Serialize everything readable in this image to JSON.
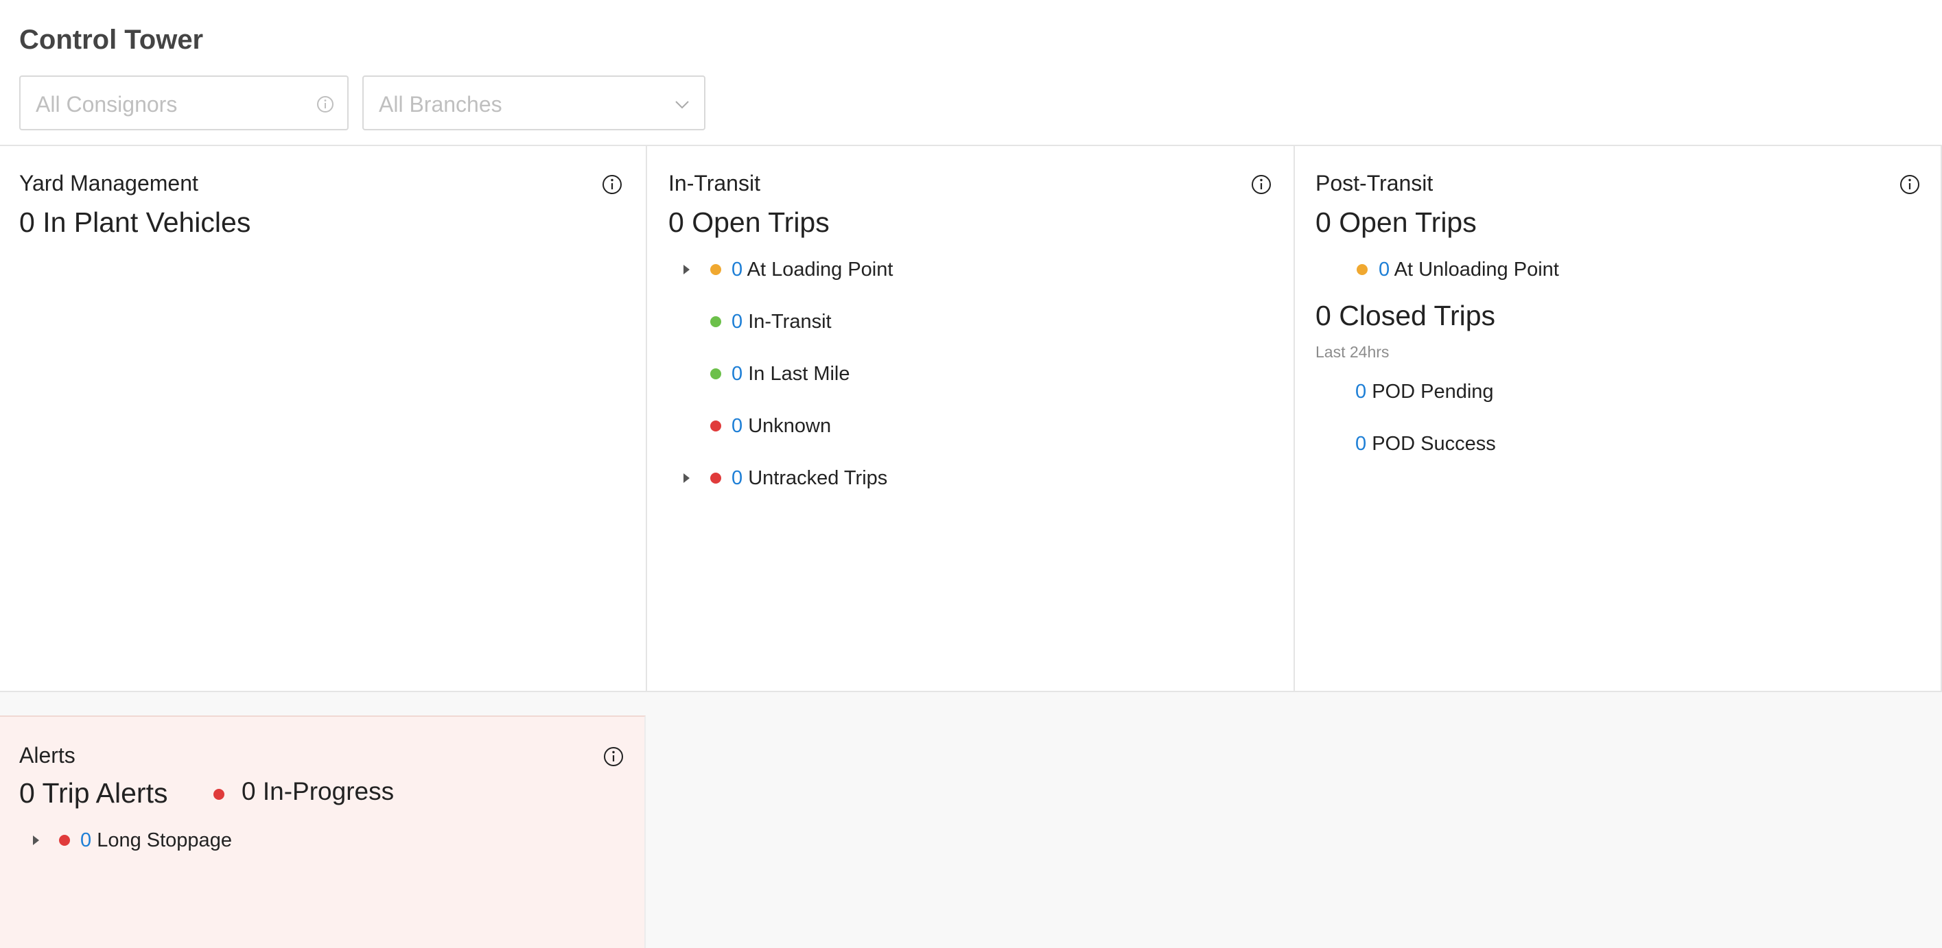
{
  "header": {
    "title": "Control Tower",
    "consignor_filter": {
      "placeholder": "All Consignors"
    },
    "branch_filter": {
      "placeholder": "All Branches"
    }
  },
  "colors": {
    "amber": "#f0a830",
    "green": "#6cc04a",
    "red": "#e03b3b",
    "link_blue": "#1e7fd6"
  },
  "yard": {
    "title": "Yard Management",
    "summary": "0 In Plant Vehicles"
  },
  "in_transit": {
    "title": "In-Transit",
    "summary": "0 Open Trips",
    "rows": [
      {
        "count": "0",
        "label": "At Loading Point",
        "status": "amber",
        "expandable": true
      },
      {
        "count": "0",
        "label": "In-Transit",
        "status": "green",
        "expandable": false
      },
      {
        "count": "0",
        "label": "In Last Mile",
        "status": "green",
        "expandable": false
      },
      {
        "count": "0",
        "label": "Unknown",
        "status": "red",
        "expandable": false
      },
      {
        "count": "0",
        "label": "Untracked Trips",
        "status": "red",
        "expandable": true
      }
    ]
  },
  "post_transit": {
    "title": "Post-Transit",
    "summary": "0 Open Trips",
    "open_rows": [
      {
        "count": "0",
        "label": "At Unloading Point",
        "status": "amber"
      }
    ],
    "closed_summary": "0 Closed Trips",
    "closed_note": "Last 24hrs",
    "closed_rows": [
      {
        "count": "0",
        "label": "POD Pending"
      },
      {
        "count": "0",
        "label": "POD Success"
      }
    ]
  },
  "alerts": {
    "title": "Alerts",
    "summary": "0 Trip Alerts",
    "in_progress": "0 In-Progress",
    "rows": [
      {
        "count": "0",
        "label": "Long Stoppage",
        "status": "red",
        "expandable": true
      }
    ]
  }
}
